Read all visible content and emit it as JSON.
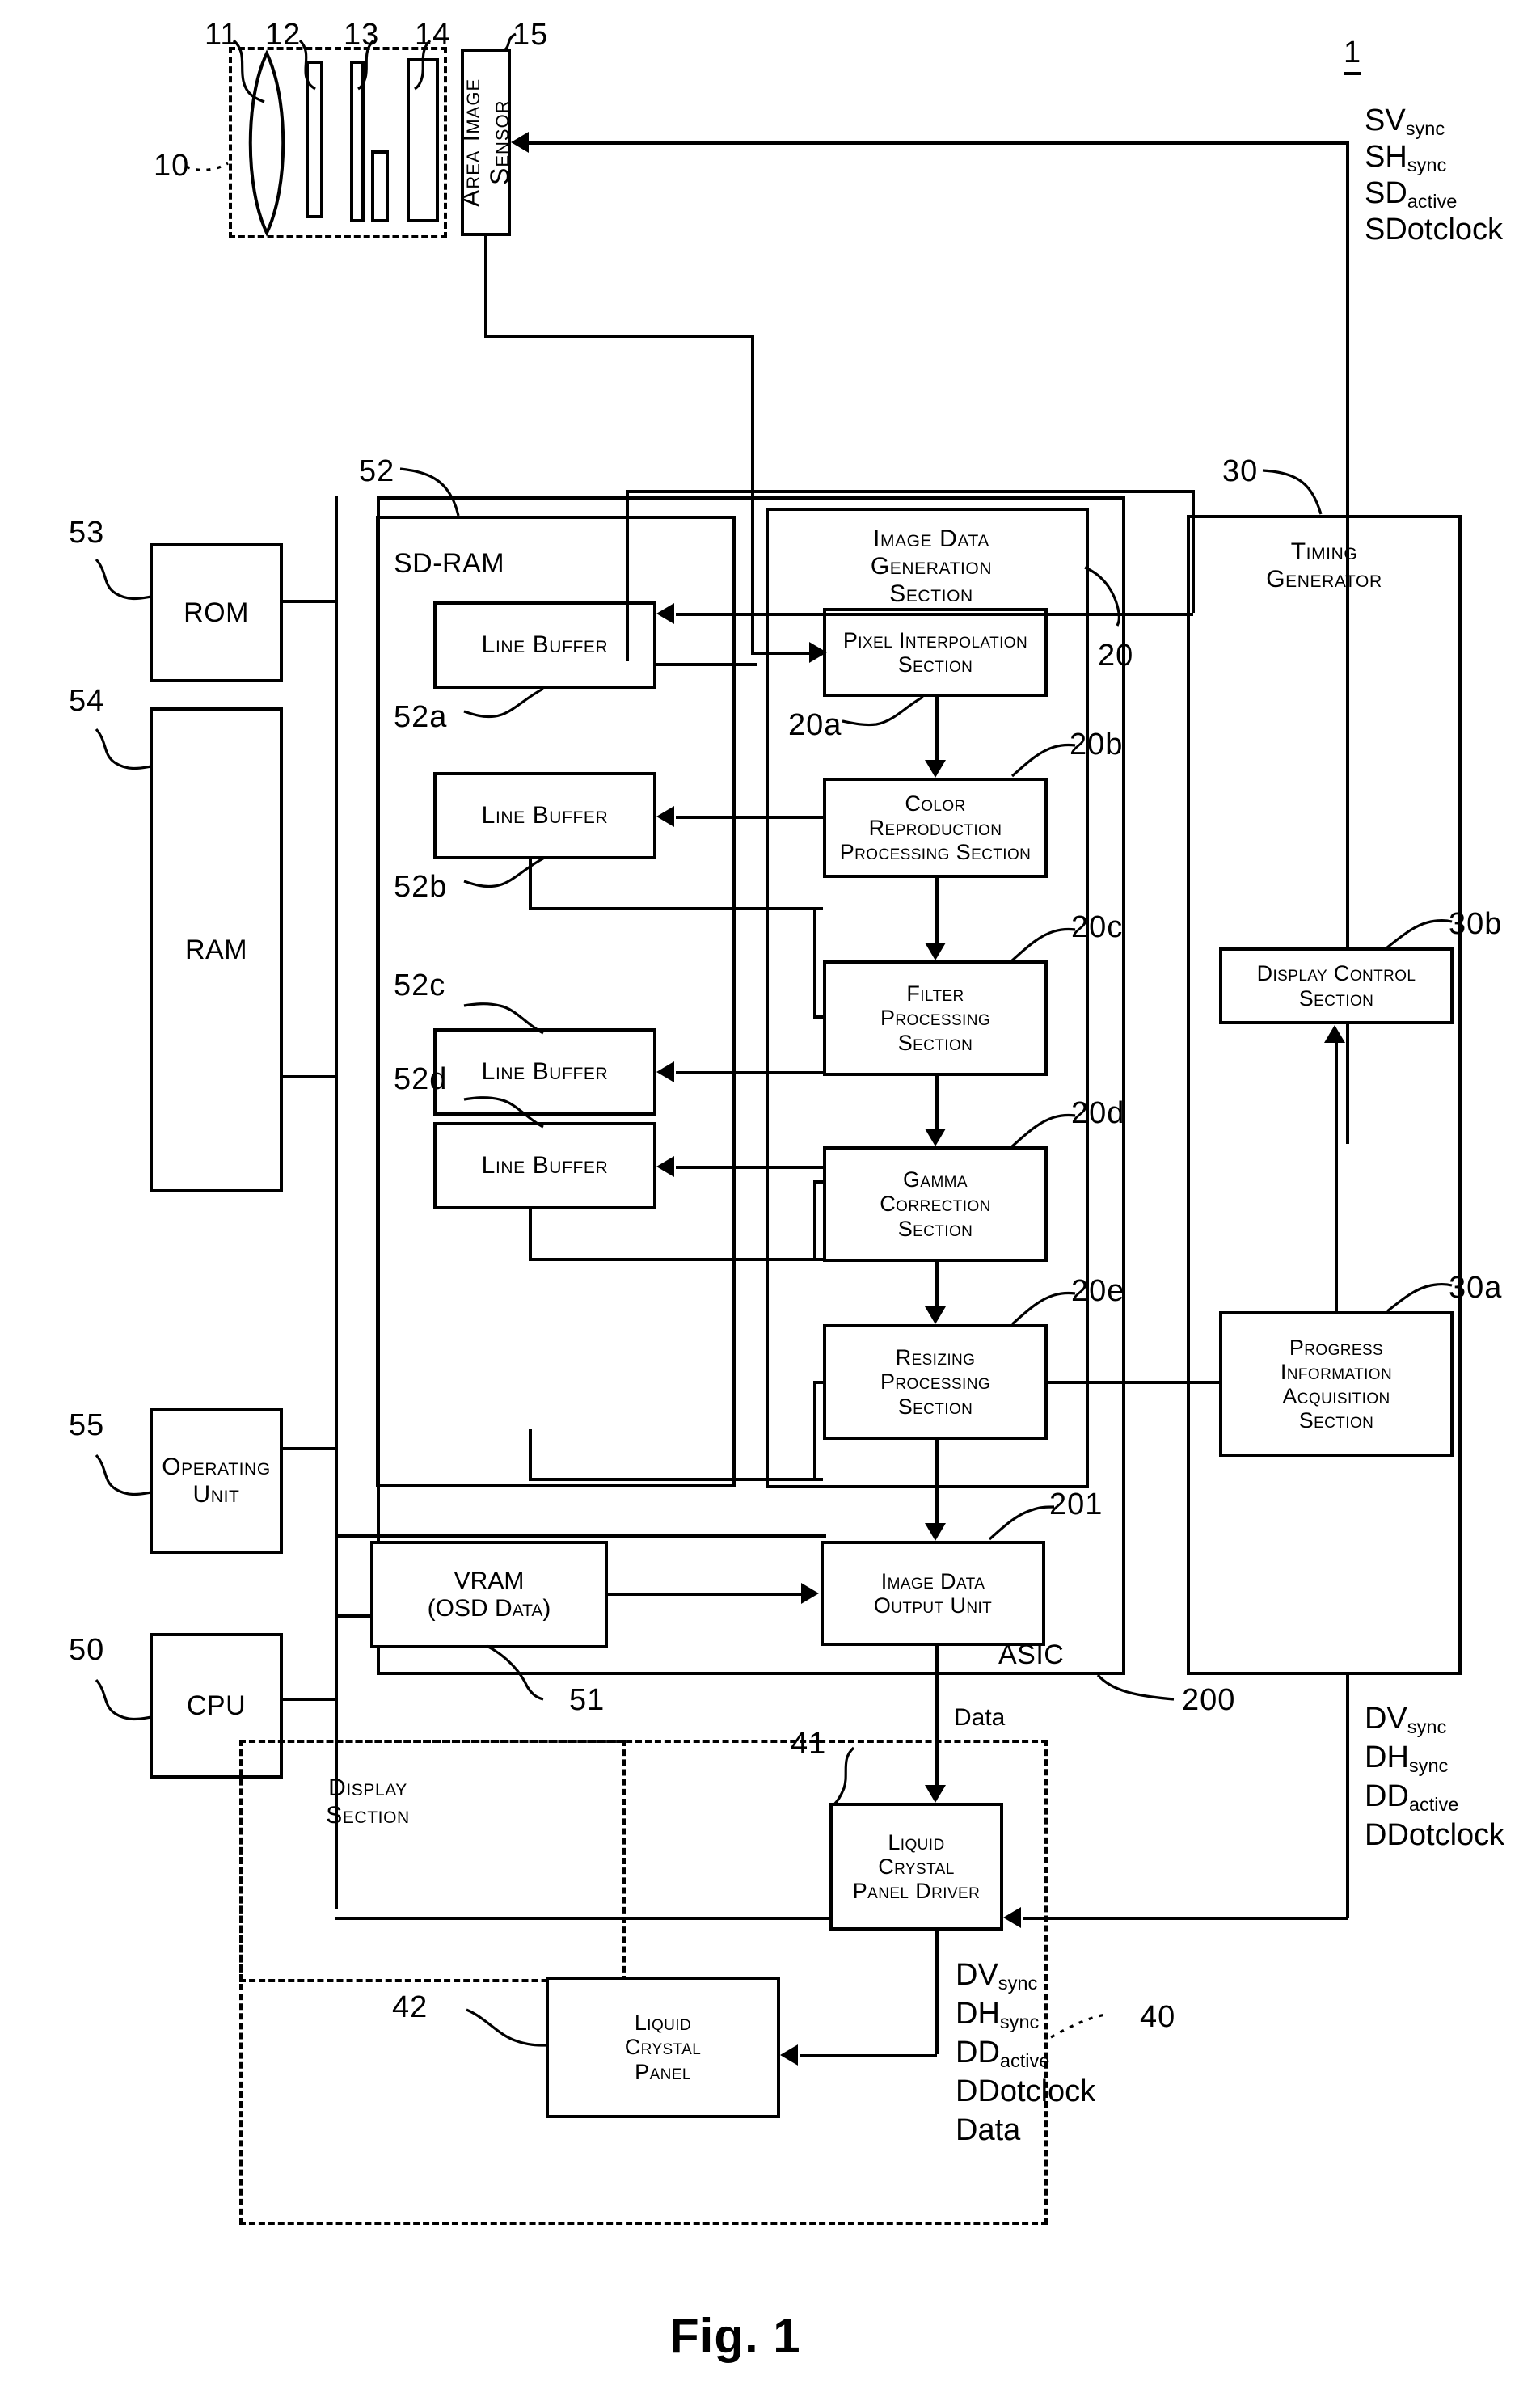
{
  "figure": {
    "caption": "Fig. 1",
    "system_ref": "1"
  },
  "optical_block": {
    "ref": "10",
    "elements": [
      {
        "ref": "11",
        "name": "lens"
      },
      {
        "ref": "12",
        "name": "optical-plate"
      },
      {
        "ref": "13",
        "name": "optical-plate-with-aperture"
      },
      {
        "ref": "14",
        "name": "optical-filter"
      }
    ]
  },
  "sensor": {
    "ref": "15",
    "label": "Area Image Sensor"
  },
  "sensor_signals": {
    "items": [
      {
        "base": "SV",
        "sub": "sync"
      },
      {
        "base": "SH",
        "sub": "sync"
      },
      {
        "base": "SD",
        "sub": "active"
      },
      {
        "base": "SDotclock",
        "sub": ""
      }
    ]
  },
  "display_signals": {
    "items": [
      {
        "base": "DV",
        "sub": "sync"
      },
      {
        "base": "DH",
        "sub": "sync"
      },
      {
        "base": "DD",
        "sub": "active"
      },
      {
        "base": "DDotclock",
        "sub": ""
      }
    ]
  },
  "panel_signals": {
    "items": [
      {
        "base": "DV",
        "sub": "sync"
      },
      {
        "base": "DH",
        "sub": "sync"
      },
      {
        "base": "DD",
        "sub": "active"
      },
      {
        "base": "DDotclock",
        "sub": ""
      },
      {
        "base": "Data",
        "sub": ""
      }
    ]
  },
  "data_label": "Data",
  "sdram": {
    "ref": "52",
    "label": "SD-RAM",
    "buffers": [
      {
        "ref": "52a",
        "label": "Line Buffer"
      },
      {
        "ref": "52b",
        "label": "Line Buffer"
      },
      {
        "ref": "52c",
        "label": "Line Buffer"
      },
      {
        "ref": "52d",
        "label": "Line Buffer"
      }
    ]
  },
  "asic": {
    "ref": "200",
    "label": "ASIC",
    "image_data_generation": {
      "ref": "20",
      "label": "Image Data\nGeneration\nSection",
      "stages": [
        {
          "ref": "20a",
          "label": "Pixel Interpolation\nSection"
        },
        {
          "ref": "20b",
          "label": "Color\nReproduction\nProcessing Section"
        },
        {
          "ref": "20c",
          "label": "Filter\nProcessing\nSection"
        },
        {
          "ref": "20d",
          "label": "Gamma\nCorrection\nSection"
        },
        {
          "ref": "20e",
          "label": "Resizing\nProcessing\nSection"
        }
      ]
    },
    "output_unit": {
      "ref": "201",
      "label": "Image Data\nOutput Unit"
    }
  },
  "timing_generator": {
    "ref": "30",
    "label": "Timing\nGenerator",
    "display_control": {
      "ref": "30b",
      "label": "Display Control\nSection"
    },
    "progress_acquisition": {
      "ref": "30a",
      "label": "Progress\nInformation\nAcquisition\nSection"
    }
  },
  "memory_blocks": [
    {
      "ref": "53",
      "label": "ROM"
    },
    {
      "ref": "54",
      "label": "RAM"
    },
    {
      "ref": "55",
      "label": "Operating\nUnit"
    },
    {
      "ref": "50",
      "label": "CPU"
    }
  ],
  "vram": {
    "ref": "51",
    "label": "VRAM\n(OSD Data)"
  },
  "display_section": {
    "ref": "40",
    "label": "Display\nSection",
    "driver": {
      "ref": "41",
      "label": "Liquid\nCrystal\nPanel Driver"
    },
    "panel": {
      "ref": "42",
      "label": "Liquid\nCrystal\nPanel"
    }
  }
}
